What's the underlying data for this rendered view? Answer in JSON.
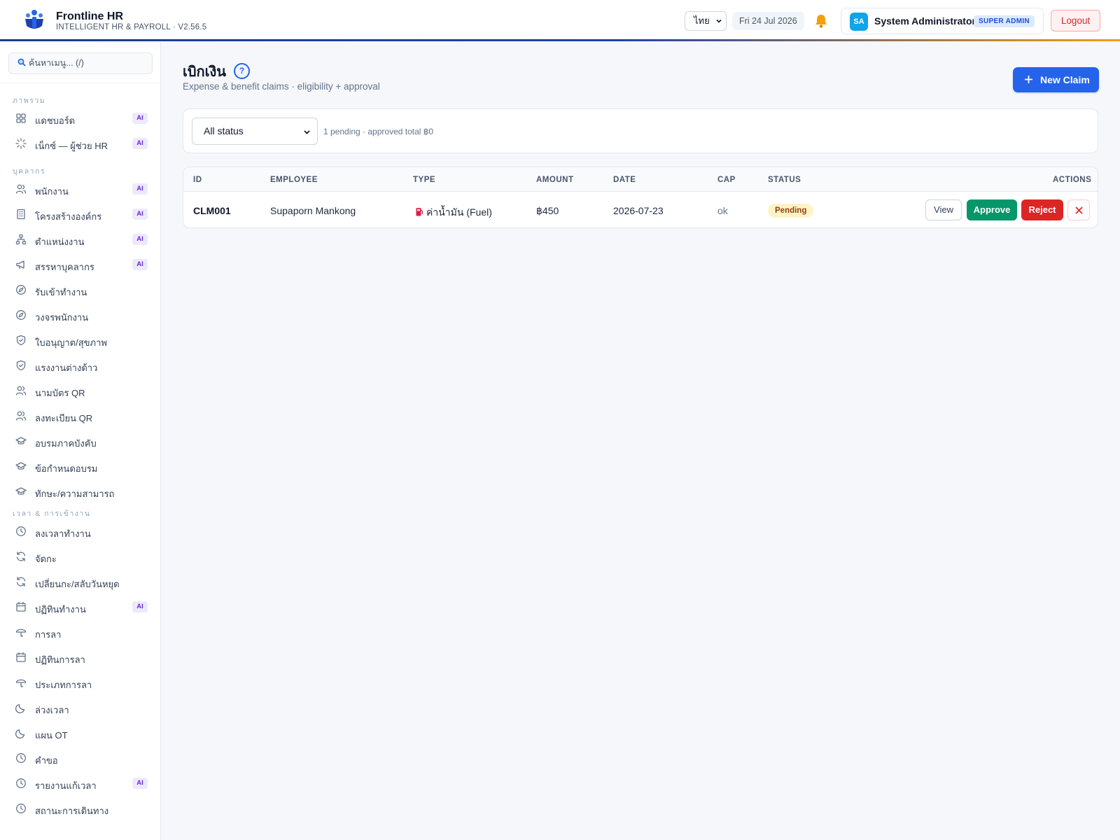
{
  "app": {
    "title": "Frontline HR",
    "subtitle": "INTELLIGENT HR & PAYROLL · V2.56.5",
    "language": "ไทย",
    "date": "Fri 24 Jul 2026",
    "user": {
      "initials": "SA",
      "name": "System Administrator",
      "role": "SUPER ADMIN"
    },
    "logout_label": "Logout",
    "brand_color": "#2563eb"
  },
  "sidebar": {
    "search_placeholder": "ค้นหาเมนู... (/)",
    "sections": [
      {
        "title": "ภาพรวม",
        "items": [
          {
            "label": "แดชบอร์ด",
            "icon": "grid-icon",
            "ai": "AI"
          },
          {
            "label": "เน็กซ์ — ผู้ช่วย HR",
            "icon": "sparkle-icon",
            "ai": "AI"
          }
        ]
      },
      {
        "title": "บุคลากร",
        "items": [
          {
            "label": "พนักงาน",
            "icon": "users-icon",
            "ai": "AI"
          },
          {
            "label": "โครงสร้างองค์กร",
            "icon": "building-icon",
            "ai": "AI"
          },
          {
            "label": "ตำแหน่งงาน",
            "icon": "org-icon",
            "ai": "AI"
          },
          {
            "label": "สรรหาบุคลากร",
            "icon": "megaphone-icon",
            "ai": "AI"
          },
          {
            "label": "รับเข้าทำงาน",
            "icon": "compass-icon"
          },
          {
            "label": "วงจรพนักงาน",
            "icon": "compass-icon"
          },
          {
            "label": "ใบอนุญาต/สุขภาพ",
            "icon": "shield-icon"
          },
          {
            "label": "แรงงานต่างด้าว",
            "icon": "shield-icon"
          },
          {
            "label": "นามบัตร QR",
            "icon": "users-icon"
          },
          {
            "label": "ลงทะเบียน QR",
            "icon": "users-icon"
          },
          {
            "label": "อบรมภาคบังคับ",
            "icon": "cap-icon"
          },
          {
            "label": "ข้อกำหนดอบรม",
            "icon": "cap-icon"
          },
          {
            "label": "ทักษะ/ความสามารถ",
            "icon": "cap-icon"
          }
        ]
      },
      {
        "title": "เวลา & การเข้างาน",
        "items": [
          {
            "label": "ลงเวลาทำงาน",
            "icon": "clock-icon"
          },
          {
            "label": "จัดกะ",
            "icon": "refresh-icon"
          },
          {
            "label": "เปลี่ยนกะ/สลับวันหยุด",
            "icon": "refresh-icon"
          },
          {
            "label": "ปฏิทินทำงาน",
            "icon": "calendar-icon",
            "ai": "AI"
          },
          {
            "label": "การลา",
            "icon": "umbrella-icon"
          },
          {
            "label": "ปฏิทินการลา",
            "icon": "calendar-icon"
          },
          {
            "label": "ประเภทการลา",
            "icon": "umbrella-icon"
          },
          {
            "label": "ล่วงเวลา",
            "icon": "moon-icon"
          },
          {
            "label": "แผน OT",
            "icon": "moon-icon"
          },
          {
            "label": "คำขอ",
            "icon": "clock-icon"
          },
          {
            "label": "รายงานแก้เวลา",
            "icon": "clock-icon",
            "ai": "AI"
          },
          {
            "label": "สถานะการเดินทาง",
            "icon": "clock-icon"
          }
        ]
      }
    ]
  },
  "main": {
    "title": "เบิกเงิน",
    "help": "?",
    "subtitle": "Expense & benefit claims · eligibility + approval",
    "new_claim_label": "New Claim",
    "filter": {
      "status_value": "All status",
      "summary": "1 pending · approved total ฿0"
    },
    "table": {
      "columns": [
        "ID",
        "EMPLOYEE",
        "TYPE",
        "AMOUNT",
        "DATE",
        "CAP",
        "STATUS",
        "ACTIONS"
      ],
      "rows": [
        {
          "id": "CLM001",
          "employee": "Supaporn Mankong",
          "type": "ค่าน้ำมัน (Fuel)",
          "type_icon": "fuel-icon",
          "amount": "฿450",
          "date": "2026-07-23",
          "cap": "ok",
          "status": "Pending",
          "actions": {
            "view": "View",
            "approve": "Approve",
            "reject": "Reject",
            "delete": "×"
          }
        }
      ]
    }
  }
}
